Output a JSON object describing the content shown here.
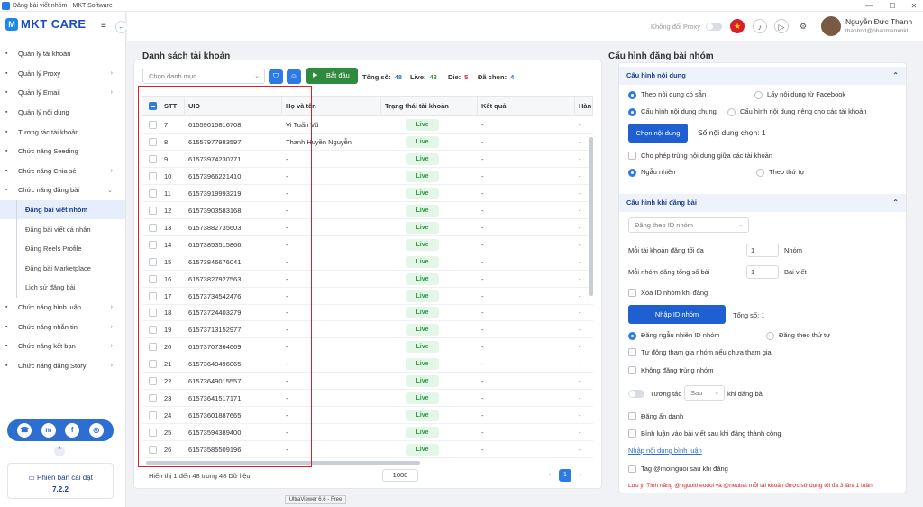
{
  "window": {
    "title": "Đăng bài viết nhóm - MKT Software"
  },
  "logo": {
    "text": "MKT CARE"
  },
  "sidebar": {
    "items": [
      {
        "label": "Quản lý tài khoản",
        "icon": "grid-icon",
        "chev": ""
      },
      {
        "label": "Quản lý Proxy",
        "icon": "user-icon",
        "chev": "›"
      },
      {
        "label": "Quản lý Email",
        "icon": "mail-icon",
        "chev": "›"
      },
      {
        "label": "Quản lý nội dung",
        "icon": "list-icon",
        "chev": ""
      },
      {
        "label": "Tương tác tài khoản",
        "icon": "tool-icon",
        "chev": ""
      },
      {
        "label": "Chức năng Seeding",
        "icon": "seed-icon",
        "chev": ""
      },
      {
        "label": "Chức năng Chia sẻ",
        "icon": "share-icon",
        "chev": "›"
      },
      {
        "label": "Chức năng đăng bài",
        "icon": "post-icon",
        "chev": "⌄"
      }
    ],
    "subitems": [
      {
        "label": "Đăng bài viết nhóm",
        "active": true
      },
      {
        "label": "Đăng bài viết cá nhân",
        "active": false
      },
      {
        "label": "Đăng Reels Profile",
        "active": false
      },
      {
        "label": "Đăng bài Marketplace",
        "active": false
      },
      {
        "label": "Lịch sử đăng bài",
        "active": false
      }
    ],
    "items2": [
      {
        "label": "Chức năng bình luận",
        "icon": "comment-icon",
        "chev": "›"
      },
      {
        "label": "Chức năng nhắn tin",
        "icon": "message-icon",
        "chev": "›"
      },
      {
        "label": "Chức năng kết bạn",
        "icon": "friend-icon",
        "chev": "›"
      },
      {
        "label": "Chức năng đăng Story",
        "icon": "story-icon",
        "chev": "›"
      }
    ],
    "version_label": "Phiên bản cài đặt",
    "version": "7.2.2"
  },
  "topbar": {
    "proxy_label": "Không đổi Proxy",
    "user_name": "Nguyễn Đức Thanh",
    "user_email": "thanhnd@phanmemmkt..."
  },
  "left": {
    "title": "Danh sách tài khoản",
    "category_placeholder": "Chọn danh mục",
    "start_label": "Bắt đầu",
    "stats": [
      {
        "label": "Tổng số:",
        "value": "48",
        "color": "#2c6fd1"
      },
      {
        "label": "Live:",
        "value": "43",
        "color": "#2e9a47"
      },
      {
        "label": "Die:",
        "value": "5",
        "color": "#d9202a"
      },
      {
        "label": "Đã chọn:",
        "value": "4",
        "color": "#2c6fd1"
      }
    ],
    "columns": [
      "STT",
      "UID",
      "Họ và tên",
      "Trạng thái tài khoản",
      "Kết quả",
      "Hàn"
    ],
    "rows": [
      {
        "stt": "7",
        "uid": "61559015816708",
        "name": "Vi Tuấn Vũ",
        "status": "Live",
        "result": "-",
        "extra": "-"
      },
      {
        "stt": "8",
        "uid": "61557977983597",
        "name": "Thanh Huyền Nguyễn",
        "status": "Live",
        "result": "-",
        "extra": "-"
      },
      {
        "stt": "9",
        "uid": "61573974230771",
        "name": "-",
        "status": "Live",
        "result": "-",
        "extra": "-"
      },
      {
        "stt": "10",
        "uid": "61573966221410",
        "name": "-",
        "status": "Live",
        "result": "-",
        "extra": "-"
      },
      {
        "stt": "11",
        "uid": "61573919993219",
        "name": "-",
        "status": "Live",
        "result": "-",
        "extra": "-"
      },
      {
        "stt": "12",
        "uid": "61573903583168",
        "name": "-",
        "status": "Live",
        "result": "-",
        "extra": "-"
      },
      {
        "stt": "13",
        "uid": "61573882735603",
        "name": "-",
        "status": "Live",
        "result": "-",
        "extra": "-"
      },
      {
        "stt": "14",
        "uid": "61573853515866",
        "name": "-",
        "status": "Live",
        "result": "-",
        "extra": "-"
      },
      {
        "stt": "15",
        "uid": "61573846676041",
        "name": "-",
        "status": "Live",
        "result": "-",
        "extra": "-"
      },
      {
        "stt": "16",
        "uid": "61573827927563",
        "name": "-",
        "status": "Live",
        "result": "-",
        "extra": "-"
      },
      {
        "stt": "17",
        "uid": "61573734542476",
        "name": "-",
        "status": "Live",
        "result": "-",
        "extra": "-"
      },
      {
        "stt": "18",
        "uid": "61573724403279",
        "name": "-",
        "status": "Live",
        "result": "-",
        "extra": "-"
      },
      {
        "stt": "19",
        "uid": "61573713152977",
        "name": "-",
        "status": "Live",
        "result": "-",
        "extra": "-"
      },
      {
        "stt": "20",
        "uid": "61573707364669",
        "name": "-",
        "status": "Live",
        "result": "-",
        "extra": "-"
      },
      {
        "stt": "21",
        "uid": "61573649496065",
        "name": "-",
        "status": "Live",
        "result": "-",
        "extra": "-"
      },
      {
        "stt": "22",
        "uid": "61573649015557",
        "name": "-",
        "status": "Live",
        "result": "-",
        "extra": "-"
      },
      {
        "stt": "23",
        "uid": "61573641517171",
        "name": "-",
        "status": "Live",
        "result": "-",
        "extra": "-"
      },
      {
        "stt": "24",
        "uid": "61573601887665",
        "name": "-",
        "status": "Live",
        "result": "-",
        "extra": "-"
      },
      {
        "stt": "25",
        "uid": "61573594389400",
        "name": "-",
        "status": "Live",
        "result": "-",
        "extra": "-"
      },
      {
        "stt": "26",
        "uid": "61573585509196",
        "name": "-",
        "status": "Live",
        "result": "-",
        "extra": "-"
      }
    ],
    "footer": "Hiển thị 1 đến 48 trong 48 Dữ liệu",
    "page_size": "1000",
    "current_page": "1"
  },
  "right": {
    "title": "Cấu hình đăng bài nhóm",
    "sec1": "Cấu hình nội dung",
    "opt_existing": "Theo nội dung có sẵn",
    "opt_facebook": "Lấy nội dung từ Facebook",
    "opt_common": "Cấu hình nội dung chung",
    "opt_separate": "Cấu hình nội dung riêng cho các tài khoản",
    "choose_content_btn": "Chọn nội dung",
    "chosen_count": "Số nội dung chọn: 1",
    "allow_duplicate": "Cho phép trùng nội dung giữa các tài khoản",
    "random": "Ngẫu nhiên",
    "in_order": "Theo thứ tự",
    "sec2": "Cấu hình khi đăng bài",
    "post_by": "Đăng theo ID nhóm",
    "max_per_account_label": "Mỗi tài khoản đăng tối đa",
    "max_per_account": "1",
    "max_per_account_unit": "Nhóm",
    "per_group_label": "Mỗi nhóm đăng tổng số bài",
    "per_group": "1",
    "per_group_unit": "Bài viết",
    "delete_group_id": "Xóa ID nhóm khi đăng",
    "import_group_btn": "Nhập ID nhóm",
    "total_label": "Tổng số:",
    "total_value": "1",
    "random_group": "Đăng ngẫu nhiên ID nhóm",
    "order_group": "Đăng theo thứ tự",
    "auto_join": "Tự động tham gia nhóm nếu chưa tham gia",
    "no_duplicate_group": "Không đăng trùng nhóm",
    "interact_label": "Tương tác",
    "interact_when": "Sau",
    "interact_suffix": "khi đăng bài",
    "anonymous": "Đăng ẩn danh",
    "comment_after": "Bình luận vào bài viết sau khi đăng thành công",
    "comment_link": "Nhập nội dung bình luận",
    "tag_everyone": "Tag @moinguoi sau khi đăng",
    "note": "Lưu ý: Tính năng @nguoitheodoi và @neubat mỗi tài khoản được sử dụng tối đa 3 lần/ 1 tuần"
  },
  "overlay": {
    "label": "UltraViewer 6.6 - Free"
  }
}
